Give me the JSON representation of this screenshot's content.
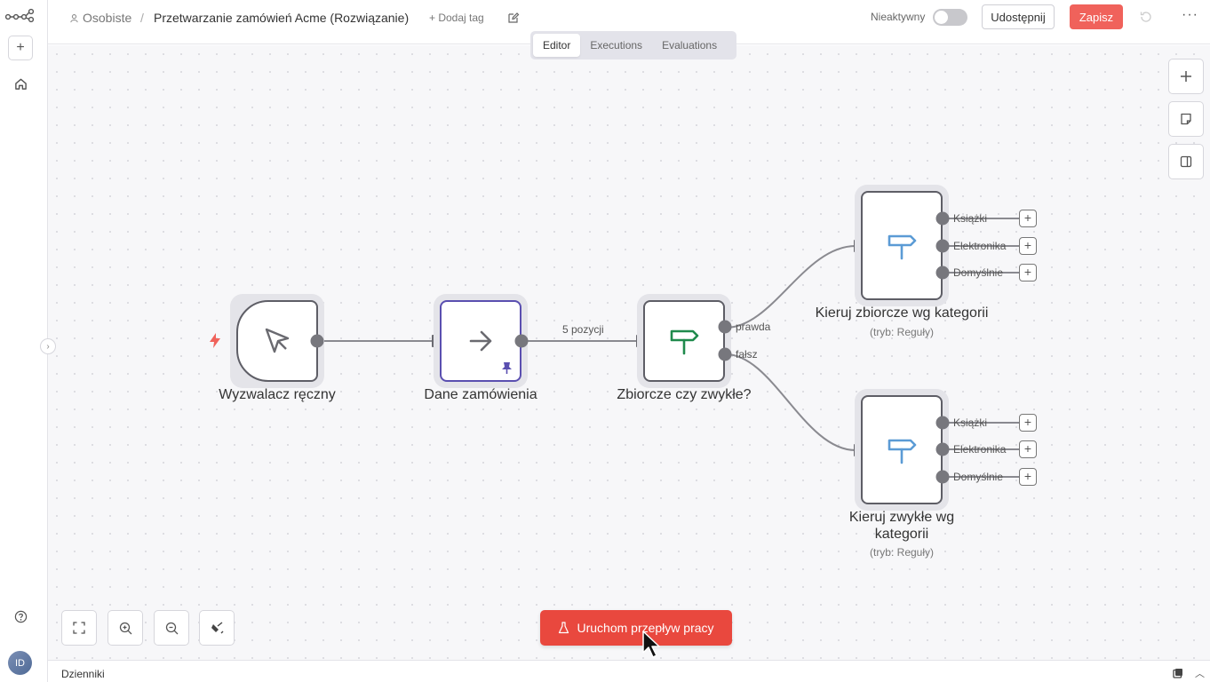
{
  "header": {
    "project": "Osobiste",
    "separator": "/",
    "workflow_title": "Przetwarzanie zamówień Acme (Rozwiązanie)",
    "add_tag": "+ Dodaj tag",
    "inactive_label": "Nieaktywny",
    "share_label": "Udostępnij",
    "save_label": "Zapisz",
    "more_label": "···"
  },
  "tabs": [
    {
      "label": "Editor",
      "active": true
    },
    {
      "label": "Executions",
      "active": false
    },
    {
      "label": "Evaluations",
      "active": false
    }
  ],
  "nodes": {
    "trigger": {
      "label": "Wyzwalacz ręczny"
    },
    "order_data": {
      "label": "Dane zamówienia"
    },
    "if_bulk": {
      "label": "Zbiorcze czy zwykłe?",
      "out_true": "prawda",
      "out_false": "fałsz"
    },
    "route_bulk": {
      "label": "Kieruj zbiorcze wg kategorii",
      "sub": "(tryb: Reguły)",
      "outputs": [
        "Książki",
        "Elektronika",
        "Domyślnie"
      ]
    },
    "route_regular": {
      "label_line1": "Kieruj zwykłe wg",
      "label_line2": "kategorii",
      "sub": "(tryb: Reguły)",
      "outputs": [
        "Książki",
        "Elektronika",
        "Domyślnie"
      ]
    }
  },
  "edges": {
    "items_label": "5 pozycji"
  },
  "run_button": {
    "label": "Uruchom przepływ pracy"
  },
  "logs": {
    "label": "Dzienniki"
  },
  "avatar": {
    "initials": "ID"
  },
  "colors": {
    "accent": "#f0625b",
    "run": "#e9483e",
    "pin": "#5a4fb0",
    "if_icon": "#1f8a4c",
    "switch_icon": "#5b9bd5"
  }
}
